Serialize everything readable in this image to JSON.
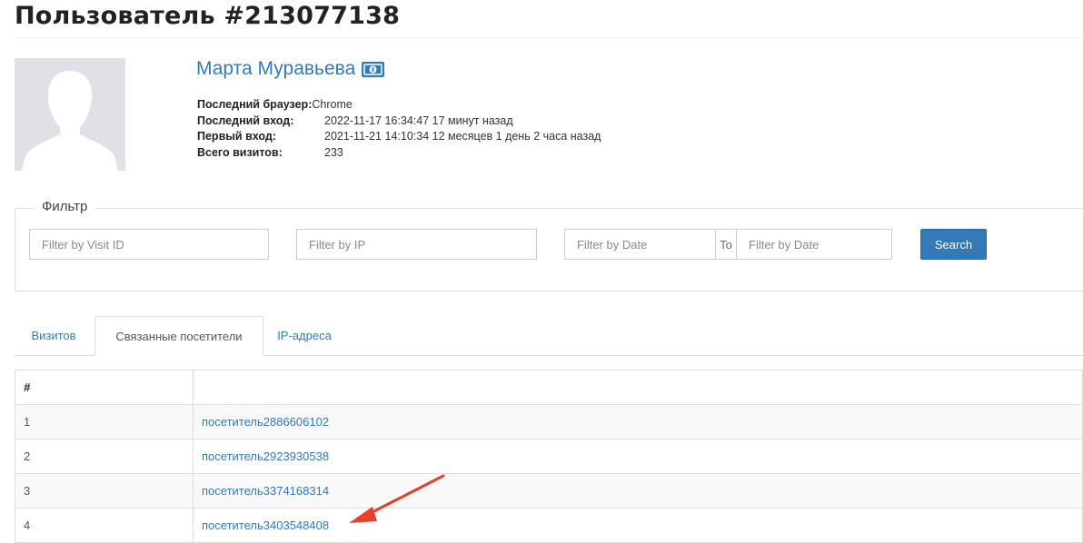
{
  "page": {
    "title": "Пользователь #213077138"
  },
  "user": {
    "name": "Марта Муравьева",
    "name_icon": "cash-icon",
    "avatar_icon": "user-silhouette-icon",
    "browser_label": "Последний браузер:",
    "browser_value": "Chrome",
    "last_login_label": "Последний вход:",
    "last_login_value": "2022-11-17 16:34:47 17 минут назад",
    "first_login_label": "Первый вход:",
    "first_login_value": "2021-11-21 14:10:34 12 месяцев 1 день 2 часа назад",
    "visits_label": "Всего визитов:",
    "visits_value": "233"
  },
  "filter": {
    "legend": "Фильтр",
    "visit_id_placeholder": "Filter by Visit ID",
    "ip_placeholder": "Filter by IP",
    "date_from_placeholder": "Filter by Date",
    "to_label": "To",
    "date_to_placeholder": "Filter by Date",
    "search_label": "Search"
  },
  "tabs": [
    {
      "label": "Визитов",
      "active": false
    },
    {
      "label": "Связанные посетители",
      "active": true
    },
    {
      "label": "IP-адреса",
      "active": false
    }
  ],
  "table": {
    "headers": [
      "#",
      ""
    ],
    "rows": [
      {
        "num": "1",
        "visitor": "посетитель2886606102"
      },
      {
        "num": "2",
        "visitor": "посетитель2923930538"
      },
      {
        "num": "3",
        "visitor": "посетитель3374168314"
      },
      {
        "num": "4",
        "visitor": "посетитель3403548408"
      }
    ]
  },
  "colors": {
    "link": "#337ab7",
    "button": "#337ab7",
    "annotation_arrow": "#e8402c"
  }
}
